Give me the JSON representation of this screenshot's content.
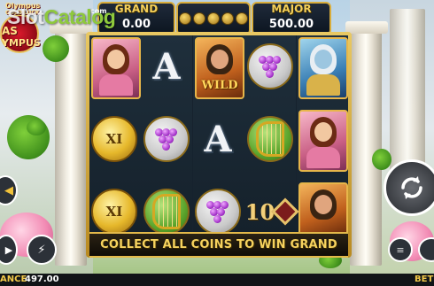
{
  "watermark": {
    "part1": "Slot",
    "part2": "Catalog"
  },
  "logo": {
    "top": "Olympus",
    "sub": "GOLD LUCK",
    "line1": "AS",
    "line2": "YMPUS"
  },
  "jackpots": {
    "grand": {
      "label": "GRAND",
      "value": "0.00"
    },
    "major": {
      "label": "MAJOR",
      "value": "500.00"
    }
  },
  "jackpot_partial_label": "com",
  "grid_symbols": [
    [
      "goddess",
      "letter-A",
      "coin-X",
      "coin-X"
    ],
    [
      "grapes-orb",
      "grapes-orb",
      "harp-orb",
      "harp-orb"
    ],
    [
      "wild",
      "letter-A",
      "grapes-orb",
      "ten"
    ],
    [
      "grapes-orb",
      "harp-orb",
      "diamond-10",
      "diamond-10"
    ],
    [
      "poseidon",
      "goddess",
      "wild-hades",
      "wild-hades"
    ]
  ],
  "symbols": {
    "wild_text": "WILD",
    "letter_a": "A",
    "coin_text": "XI",
    "ten_text": "10"
  },
  "banner": {
    "text": "COLLECT ALL COINS TO WIN GRAND"
  },
  "bottom": {
    "balance_label": "ANCE",
    "balance_value": "497.00",
    "bet_label": "BET"
  },
  "colors": {
    "gold": "#f4cf58",
    "frame": "#d9ad3c",
    "reel_bg": "#16222e"
  },
  "icons": [
    "spin-icon",
    "autoplay-icon",
    "turbo-icon",
    "coin-stack-icon",
    "back-icon"
  ]
}
